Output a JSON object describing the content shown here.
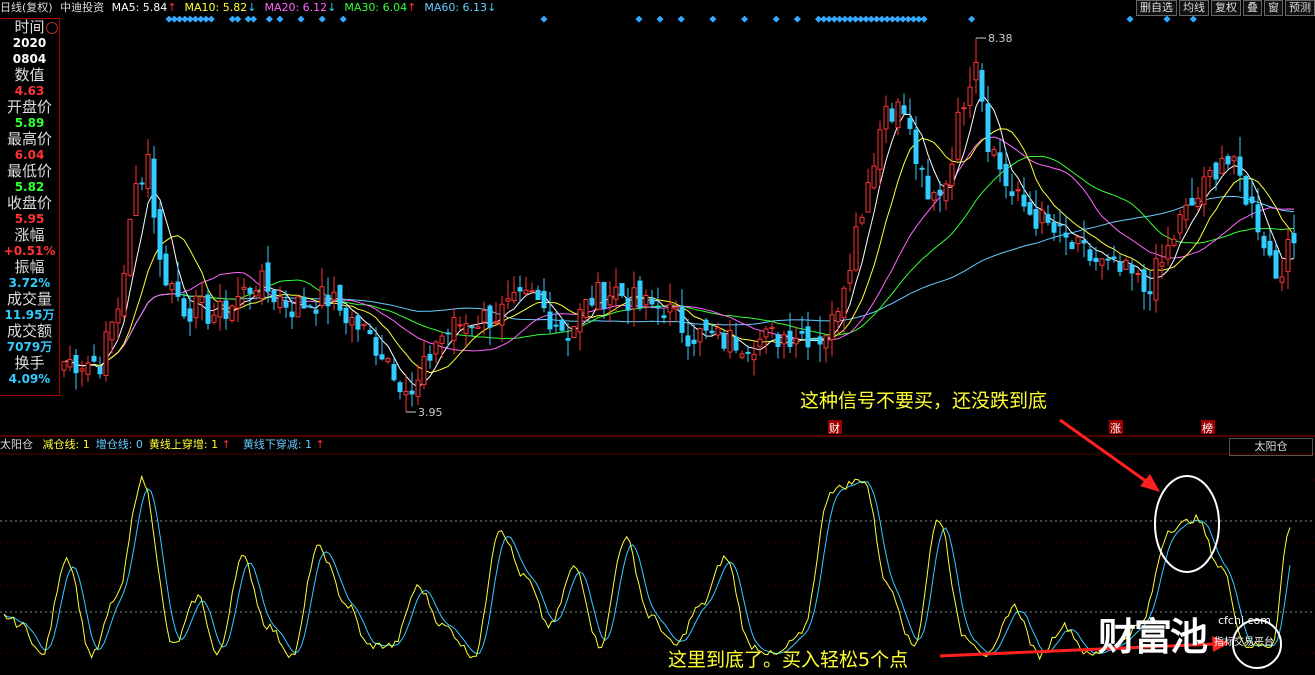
{
  "header": {
    "period": "日线(复权)",
    "stock": "中迪投资",
    "ma": [
      {
        "label": "MA5: 5.84",
        "arrow": "↑",
        "color": "#ffffff",
        "arrow_color": "#ff3333"
      },
      {
        "label": "MA10: 5.82",
        "arrow": "↓",
        "color": "#ffff33",
        "arrow_color": "#33ccff"
      },
      {
        "label": "MA20: 6.12",
        "arrow": "↓",
        "color": "#ff66ff",
        "arrow_color": "#33ccff"
      },
      {
        "label": "MA30: 6.04",
        "arrow": "↑",
        "color": "#33ff33",
        "arrow_color": "#ff3333"
      },
      {
        "label": "MA60: 6.13",
        "arrow": "↓",
        "color": "#66ccff",
        "arrow_color": "#33ccff"
      }
    ],
    "buttons": [
      "删自选",
      "均线",
      "复权",
      "叠",
      "窗",
      "预测"
    ]
  },
  "side_panel": {
    "items": [
      {
        "label": "时间",
        "values": [
          "2020",
          "0804"
        ],
        "color": "#ffffff"
      },
      {
        "label": "数值",
        "values": [
          "4.63"
        ],
        "color": "#ff3333"
      },
      {
        "label": "开盘价",
        "values": [
          "5.89"
        ],
        "color": "#33ff33"
      },
      {
        "label": "最高价",
        "values": [
          "6.04"
        ],
        "color": "#ff3333"
      },
      {
        "label": "最低价",
        "values": [
          "5.82"
        ],
        "color": "#33ff33"
      },
      {
        "label": "收盘价",
        "values": [
          "5.95"
        ],
        "color": "#ff3333"
      },
      {
        "label": "涨幅",
        "values": [
          "+0.51%"
        ],
        "color": "#ff3333"
      },
      {
        "label": "振幅",
        "values": [
          "3.72%"
        ],
        "color": "#33ccff"
      },
      {
        "label": "成交量",
        "values": [
          "11.95万"
        ],
        "color": "#33ccff"
      },
      {
        "label": "成交额",
        "values": [
          "7079万"
        ],
        "color": "#33ccff"
      },
      {
        "label": "换手",
        "values": [
          "4.09%"
        ],
        "color": "#33ccff"
      }
    ]
  },
  "lower_panel": {
    "title": "太阳仓",
    "items": [
      {
        "label": "减仓线: 1",
        "color": "#ffff33"
      },
      {
        "label": "增仓线: 0",
        "color": "#66ccff"
      },
      {
        "label": "黄线上穿增: 1",
        "arrow": "↑",
        "color": "#ffff33"
      },
      {
        "label": "黄线下穿减: 1",
        "arrow": "↑",
        "color": "#66ccff"
      }
    ],
    "selector": "太阳仓"
  },
  "annotations": {
    "signal_note": "这种信号不要买，还没跌到底",
    "bottom_note": "这里到底了。买入轻松5个点"
  },
  "badges": {
    "cai": "财",
    "zhang": "涨",
    "bang": "榜"
  },
  "watermark": {
    "brand": "财富池",
    "site": "cfchi.com",
    "slogan": "指标交易平台"
  },
  "chart_data": [
    {
      "type": "candlestick",
      "title": "",
      "price_max_label": "8.38",
      "price_min_label": "3.95",
      "price_range": [
        3.95,
        8.38
      ],
      "ma_series": [
        "MA5",
        "MA10",
        "MA20",
        "MA30",
        "MA60"
      ],
      "colors": {
        "up": "#ff3333",
        "down": "#33ccff",
        "ma5": "#ffffff",
        "ma10": "#ffff33",
        "ma20": "#ff66ff",
        "ma30": "#33ff33",
        "ma60": "#66ccff"
      }
    },
    {
      "type": "line",
      "title": "太阳仓",
      "series": [
        {
          "name": "减仓线"
        },
        {
          "name": "增仓线"
        }
      ],
      "colors": {
        "yellow": "#ffff33",
        "blue": "#33ccff"
      }
    }
  ]
}
